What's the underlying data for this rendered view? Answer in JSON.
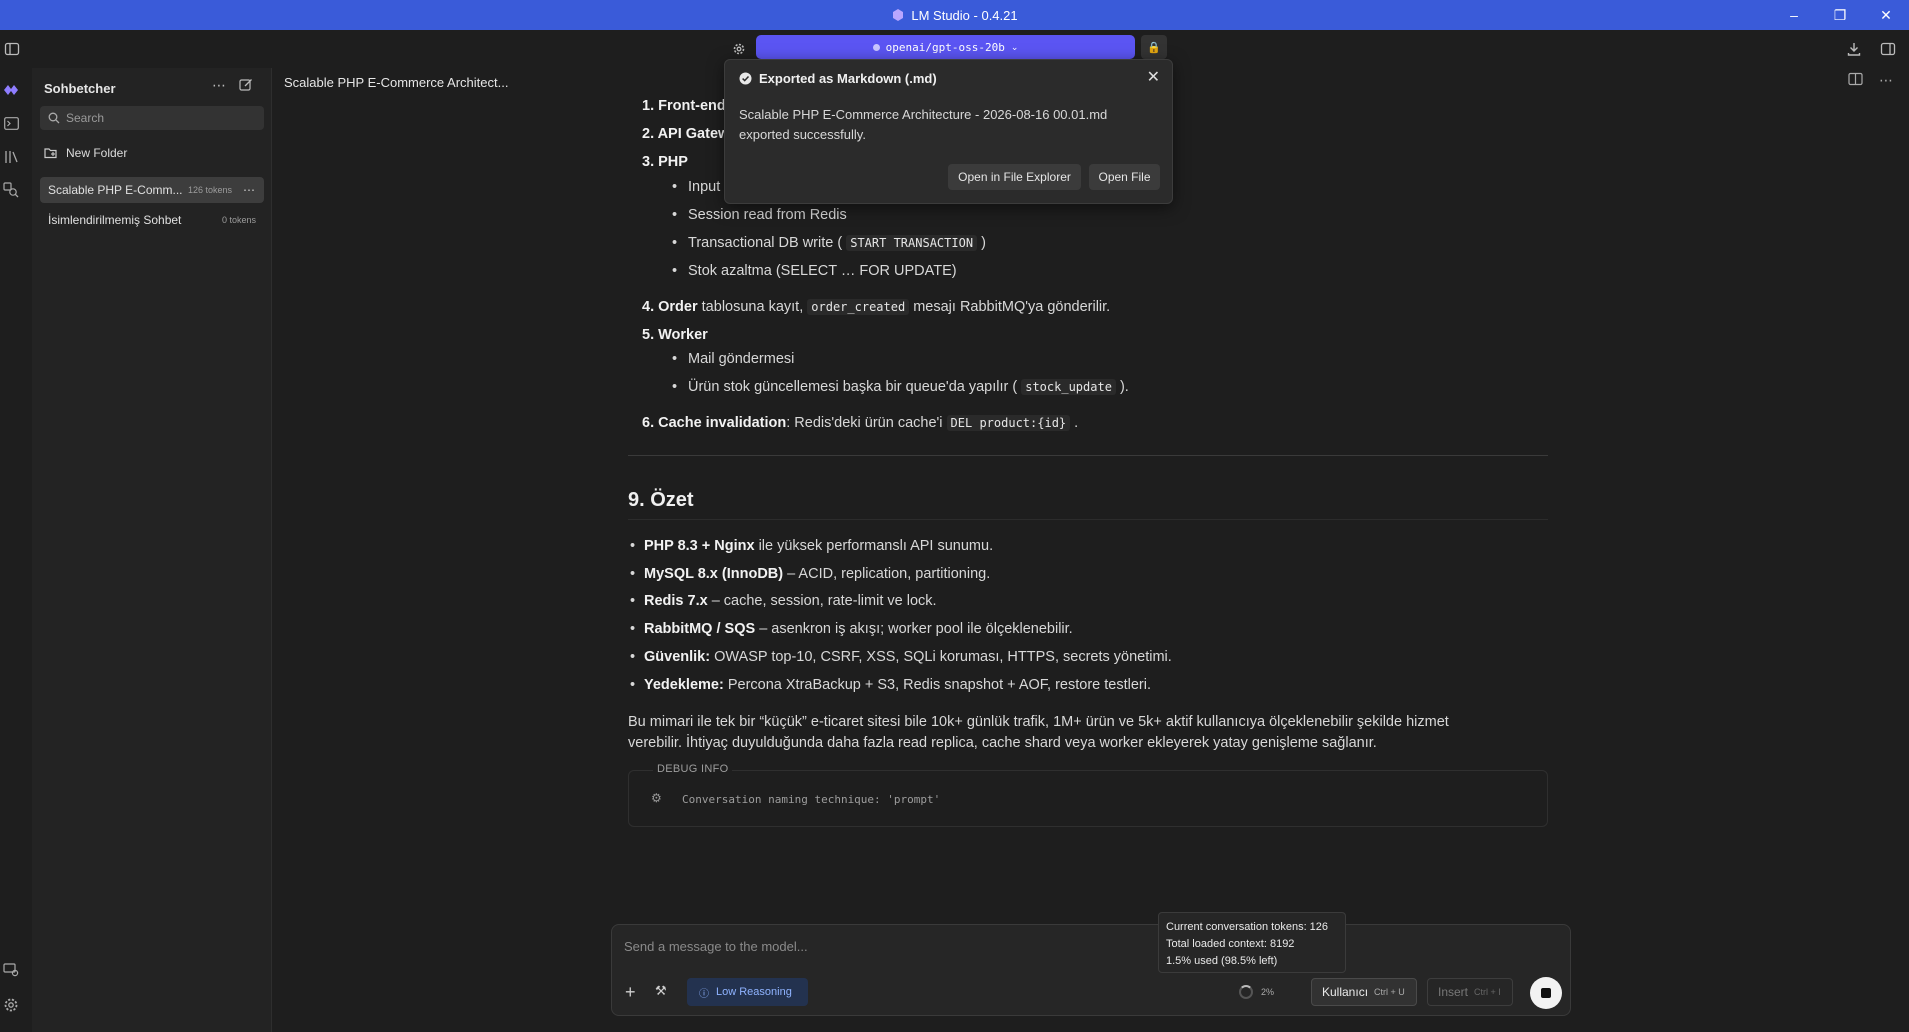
{
  "window": {
    "title": "LM Studio - 0.4.21",
    "controls": [
      "minimize",
      "restore",
      "close"
    ]
  },
  "toolbar": {
    "model": "openai/gpt-oss-20b"
  },
  "sidebar": {
    "header": "Sohbetcher",
    "search_placeholder": "Search",
    "new_folder": "New Folder",
    "chats": [
      {
        "title": "Scalable PHP E-Comm...",
        "tokens": "126 tokens",
        "active": true
      },
      {
        "title": "İsimlendirilmemiş Sohbet",
        "tokens": "0 tokens",
        "active": false
      }
    ]
  },
  "chat": {
    "title": "Scalable PHP E-Commerce Architect...",
    "steps": {
      "s1": "1. Front-end",
      "s2": "2. API Gatew",
      "s3": "3. PHP",
      "s3_items": [
        "Input",
        "Session read from Redis",
        "Transactional DB write (",
        "Stok azaltma (SELECT … FOR UPDATE)"
      ],
      "s3_code": "START TRANSACTION",
      "s4_num": "4.",
      "s4_bold": "Order",
      "s4_text1": "tablosuna kayıt,",
      "s4_code": "order_created",
      "s4_text2": "mesajı RabbitMQ'ya gönderilir.",
      "s5": "5. Worker",
      "s5_items": [
        "Mail göndermesi",
        "Ürün stok güncellemesi başka bir queue'da yapılır ("
      ],
      "s5_code": "stock_update",
      "s6_num": "6.",
      "s6_bold": "Cache invalidation",
      "s6_text": ": Redis'deki ürün cache'i",
      "s6_code": "DEL product:{id}"
    },
    "summary_heading": "9. Özet",
    "summary": [
      {
        "bold": "PHP 8.3 + Nginx",
        "text": " ile yüksek performanslı API sunumu."
      },
      {
        "bold": "MySQL 8.x (InnoDB)",
        "text": " – ACID, replication, partitioning."
      },
      {
        "bold": "Redis 7.x",
        "text": " – cache, session, rate-limit ve lock."
      },
      {
        "bold": "RabbitMQ / SQS",
        "text": " – asenkron iş akışı; worker pool ile ölçeklenebilir."
      },
      {
        "bold": "Güvenlik:",
        "text": " OWASP top-10, CSRF, XSS, SQLi koruması, HTTPS, secrets yönetimi."
      },
      {
        "bold": "Yedekleme:",
        "text": " Percona XtraBackup + S3, Redis snapshot + AOF, restore testleri."
      }
    ],
    "paragraph_line1": "Bu mimari ile tek bir “küçük” e-ticaret sitesi bile 10k+ günlük trafik, 1M+ ürün ve 5k+ aktif kullanıcıya ölçeklenebilir şekilde hizmet",
    "paragraph_line2": "verebilir. İhtiyaç duyulduğunda daha fazla read replica, cache shard veya worker ekleyerek yatay genişleme sağlanır.",
    "debug_label": "DEBUG INFO",
    "debug_text": "Conversation naming technique: 'prompt'"
  },
  "toast": {
    "title": "Exported as Markdown (.md)",
    "body_line1": "Scalable PHP E-Commerce Architecture - 2026-08-16 00.01.md",
    "body_line2": "exported successfully.",
    "btn_explorer": "Open in File Explorer",
    "btn_open": "Open File"
  },
  "composer": {
    "placeholder": "Send a message to the model...",
    "reasoning": "Low Reasoning",
    "context_percent": "2%",
    "role_label": "Kullanıcı",
    "role_shortcut": "Ctrl + U",
    "insert_label": "Insert",
    "insert_shortcut": "Ctrl + I"
  },
  "tooltip": {
    "line1": "Current conversation tokens: 126",
    "line2": "Total loaded context: 8192",
    "line3": "1.5% used (98.5% left)"
  },
  "colors": {
    "titlebar": "#3a5bd9",
    "model_selector": "#5b55f3",
    "background": "#1e1e1e"
  }
}
